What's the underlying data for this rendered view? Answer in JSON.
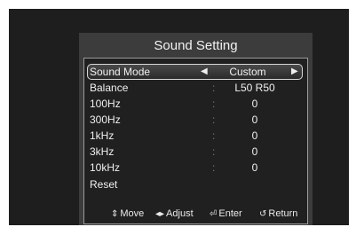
{
  "title": "Sound Setting",
  "menu": [
    {
      "label": "Sound Mode",
      "value": "Custom",
      "selected": true
    },
    {
      "label": "Balance",
      "value": "L50  R50"
    },
    {
      "label": "100Hz",
      "value": "0"
    },
    {
      "label": "300Hz",
      "value": "0"
    },
    {
      "label": "1kHz",
      "value": "0"
    },
    {
      "label": "3kHz",
      "value": "0"
    },
    {
      "label": "10kHz",
      "value": "0"
    },
    {
      "label": "Reset",
      "value": ""
    }
  ],
  "separator": ":",
  "arrows": {
    "left": "◀",
    "right": "▶"
  },
  "hints": {
    "move": {
      "icon": "⇕",
      "label": "Move"
    },
    "adjust": {
      "icon": "◂▸",
      "label": "Adjust"
    },
    "enter": {
      "icon": "⏎",
      "label": "Enter"
    },
    "return": {
      "icon": "↺",
      "label": "Return"
    }
  }
}
